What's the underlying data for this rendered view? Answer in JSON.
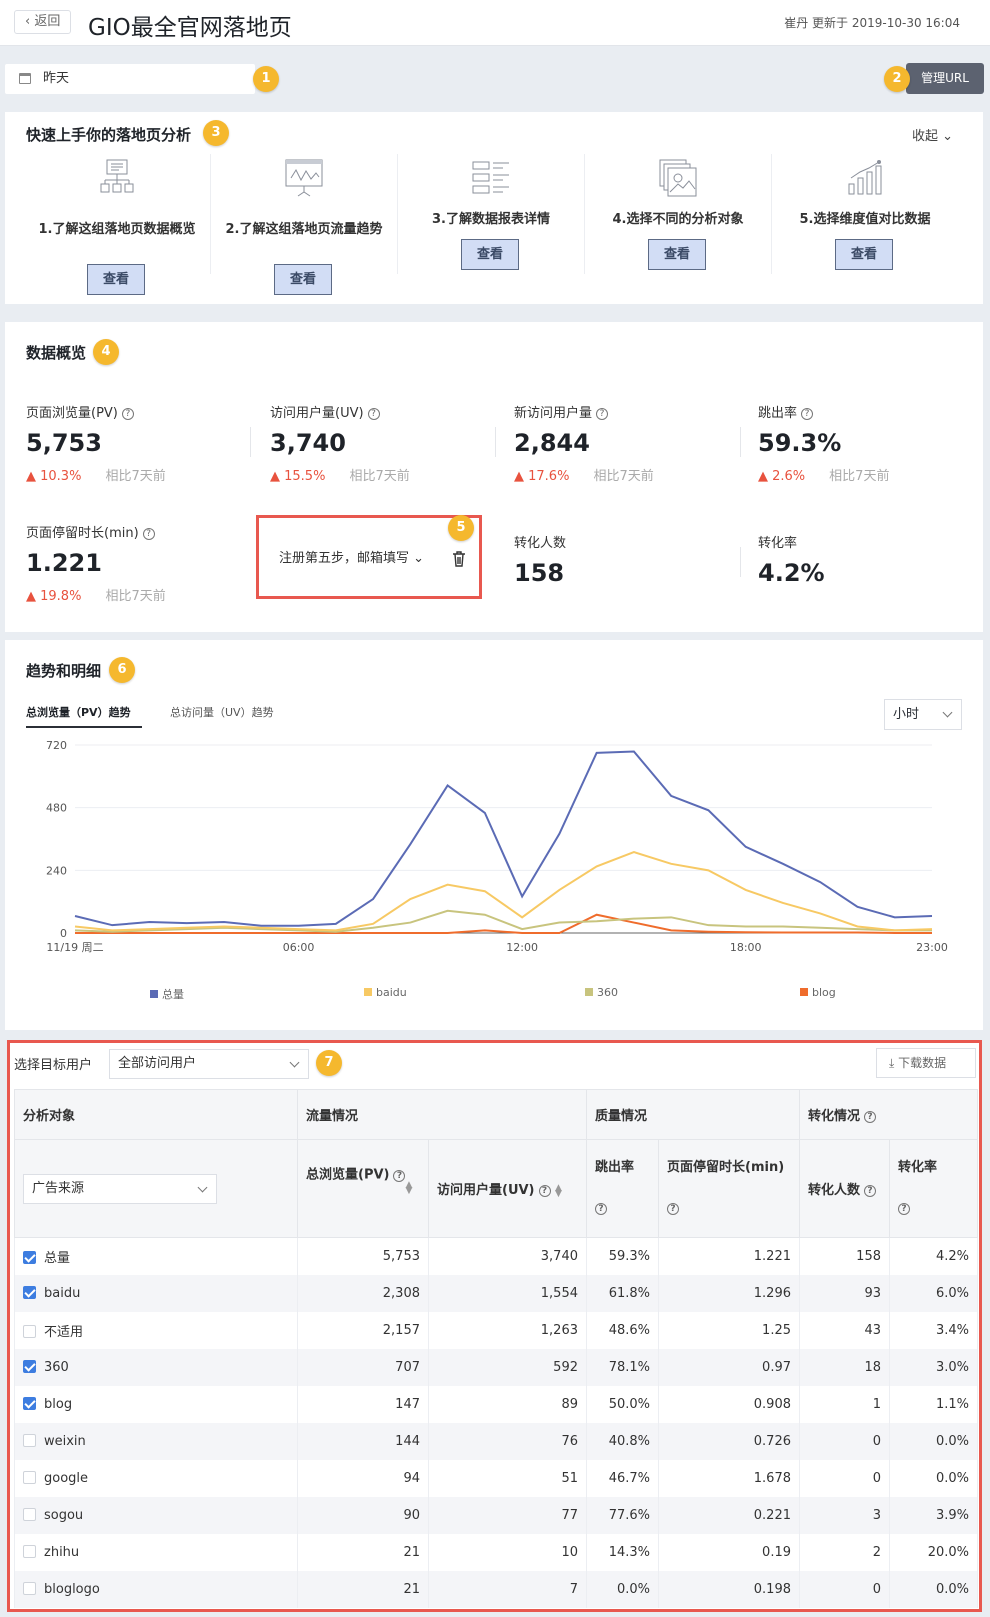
{
  "header": {
    "back_label": "返回",
    "title": "GIO最全官网落地页",
    "updated": "崔丹 更新于 2019-10-30 16:04"
  },
  "markers": [
    "1",
    "2",
    "3",
    "4",
    "5",
    "6",
    "7"
  ],
  "date_range": "昨天",
  "manage_url_label": "管理URL",
  "guide": {
    "title": "快速上手你的落地页分析",
    "collapse_label": "收起",
    "look_label": "查看",
    "steps": [
      "1.了解这组落地页数据概览",
      "2.了解这组落地页流量趋势",
      "3.了解数据报表详情",
      "4.选择不同的分析对象",
      "5.选择维度值对比数据"
    ]
  },
  "overview": {
    "title": "数据概览",
    "compare_label": "相比7天前",
    "kpis": [
      {
        "label": "页面浏览量(PV)",
        "value": "5,753",
        "change": "▲ 10.3%"
      },
      {
        "label": "访问用户量(UV)",
        "value": "3,740",
        "change": "▲ 15.5%"
      },
      {
        "label": "新访问用户量",
        "value": "2,844",
        "change": "▲ 17.6%"
      },
      {
        "label": "跳出率",
        "value": "59.3%",
        "change": "▲ 2.6%"
      },
      {
        "label": "页面停留时长(min)",
        "value": "1.221",
        "change": "▲ 19.8%"
      }
    ],
    "goal_select": "注册第五步，邮箱填写",
    "conv_count": {
      "label": "转化人数",
      "value": "158"
    },
    "conv_rate": {
      "label": "转化率",
      "value": "4.2%"
    }
  },
  "trend": {
    "title": "趋势和明细",
    "tabs": [
      "总浏览量（PV）趋势",
      "总访问量（UV）趋势"
    ],
    "granularity": "小时"
  },
  "chart_data": {
    "type": "line",
    "x": [
      "00:00",
      "01:00",
      "02:00",
      "03:00",
      "04:00",
      "05:00",
      "06:00",
      "07:00",
      "08:00",
      "09:00",
      "10:00",
      "11:00",
      "12:00",
      "13:00",
      "14:00",
      "15:00",
      "16:00",
      "17:00",
      "18:00",
      "19:00",
      "20:00",
      "21:00",
      "22:00",
      "23:00"
    ],
    "x_tick_labels": [
      "11/19 周二",
      "06:00",
      "12:00",
      "18:00",
      "23:00"
    ],
    "ylim": [
      0,
      720
    ],
    "y_ticks": [
      0,
      240,
      480,
      720
    ],
    "series": [
      {
        "name": "总量",
        "color": "#5b6bb5",
        "values": [
          65,
          30,
          42,
          38,
          42,
          28,
          28,
          35,
          130,
          340,
          565,
          460,
          140,
          380,
          690,
          695,
          525,
          470,
          330,
          265,
          195,
          100,
          60,
          65
        ]
      },
      {
        "name": "baidu",
        "color": "#f7c964",
        "values": [
          25,
          10,
          15,
          20,
          25,
          20,
          15,
          10,
          35,
          130,
          185,
          160,
          60,
          165,
          255,
          310,
          265,
          240,
          165,
          115,
          75,
          25,
          10,
          15
        ]
      },
      {
        "name": "360",
        "color": "#c8c47e",
        "values": [
          10,
          5,
          10,
          15,
          20,
          15,
          10,
          5,
          20,
          40,
          85,
          70,
          15,
          40,
          45,
          55,
          60,
          30,
          25,
          25,
          20,
          15,
          10,
          10
        ]
      },
      {
        "name": "blog",
        "color": "#ef6c2c",
        "values": [
          0,
          0,
          0,
          0,
          0,
          0,
          0,
          0,
          0,
          0,
          0,
          10,
          0,
          0,
          70,
          40,
          10,
          5,
          3,
          2,
          2,
          2,
          0,
          0
        ]
      }
    ],
    "legend_position": "bottom"
  },
  "table": {
    "target_user_label": "选择目标用户",
    "target_user_value": "全部访问用户",
    "download_label": "下载数据",
    "group_headers": [
      "分析对象",
      "流量情况",
      "质量情况",
      "转化情况"
    ],
    "dimension_select": "广告来源",
    "columns": [
      "总浏览量(PV)",
      "访问用户量(UV)",
      "跳出率",
      "页面停留时长(min)",
      "转化人数",
      "转化率"
    ],
    "rows": [
      {
        "name": "总量",
        "checked": true,
        "pv": "5,753",
        "uv": "3,740",
        "bounce": "59.3%",
        "dur": "1.221",
        "conv": "158",
        "rate": "4.2%"
      },
      {
        "name": "baidu",
        "checked": true,
        "pv": "2,308",
        "uv": "1,554",
        "bounce": "61.8%",
        "dur": "1.296",
        "conv": "93",
        "rate": "6.0%"
      },
      {
        "name": "不适用",
        "checked": false,
        "pv": "2,157",
        "uv": "1,263",
        "bounce": "48.6%",
        "dur": "1.25",
        "conv": "43",
        "rate": "3.4%"
      },
      {
        "name": "360",
        "checked": true,
        "pv": "707",
        "uv": "592",
        "bounce": "78.1%",
        "dur": "0.97",
        "conv": "18",
        "rate": "3.0%"
      },
      {
        "name": "blog",
        "checked": true,
        "pv": "147",
        "uv": "89",
        "bounce": "50.0%",
        "dur": "0.908",
        "conv": "1",
        "rate": "1.1%"
      },
      {
        "name": "weixin",
        "checked": false,
        "pv": "144",
        "uv": "76",
        "bounce": "40.8%",
        "dur": "0.726",
        "conv": "0",
        "rate": "0.0%"
      },
      {
        "name": "google",
        "checked": false,
        "pv": "94",
        "uv": "51",
        "bounce": "46.7%",
        "dur": "1.678",
        "conv": "0",
        "rate": "0.0%"
      },
      {
        "name": "sogou",
        "checked": false,
        "pv": "90",
        "uv": "77",
        "bounce": "77.6%",
        "dur": "0.221",
        "conv": "3",
        "rate": "3.9%"
      },
      {
        "name": "zhihu",
        "checked": false,
        "pv": "21",
        "uv": "10",
        "bounce": "14.3%",
        "dur": "0.19",
        "conv": "2",
        "rate": "20.0%"
      },
      {
        "name": "bloglogo",
        "checked": false,
        "pv": "21",
        "uv": "7",
        "bounce": "0.0%",
        "dur": "0.198",
        "conv": "0",
        "rate": "0.0%"
      }
    ]
  }
}
